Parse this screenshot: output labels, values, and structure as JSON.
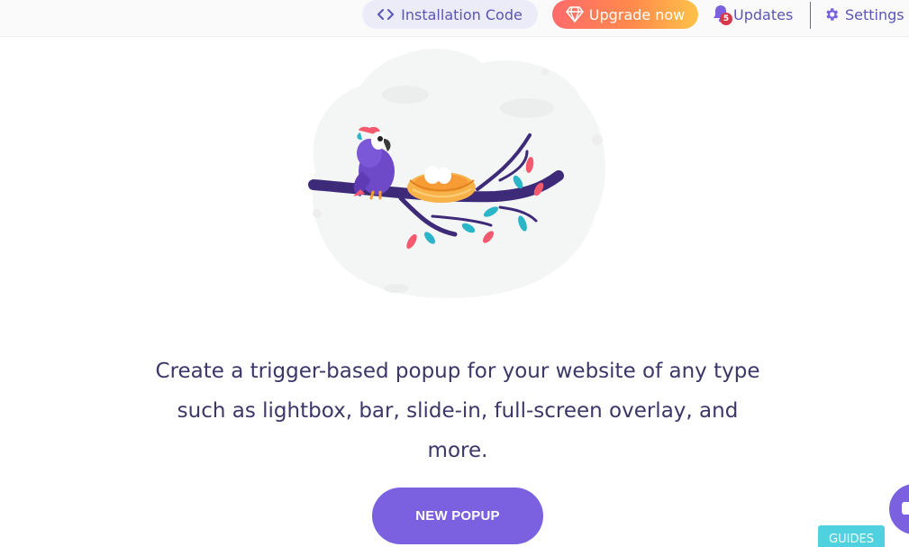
{
  "header": {
    "install_label": "Installation Code",
    "upgrade_label": "Upgrade now",
    "updates_label": "Updates",
    "updates_count": "5",
    "settings_label": "Settings"
  },
  "main": {
    "description": "Create a trigger-based popup for your website of any type such as lightbox, bar, slide-in, full-screen overlay, and more.",
    "new_popup_label": "NEW POPUP"
  },
  "footer": {
    "guides_label": "GUIDES"
  },
  "colors": {
    "accent": "#7b61e0",
    "nav_text": "#5a55b5",
    "badge": "#d9384a",
    "guides": "#4fd1e0"
  },
  "icons": {
    "install": "code-icon",
    "upgrade": "diamond-icon",
    "updates": "bell-icon",
    "settings": "gear-icon",
    "chat": "chat-icon"
  }
}
